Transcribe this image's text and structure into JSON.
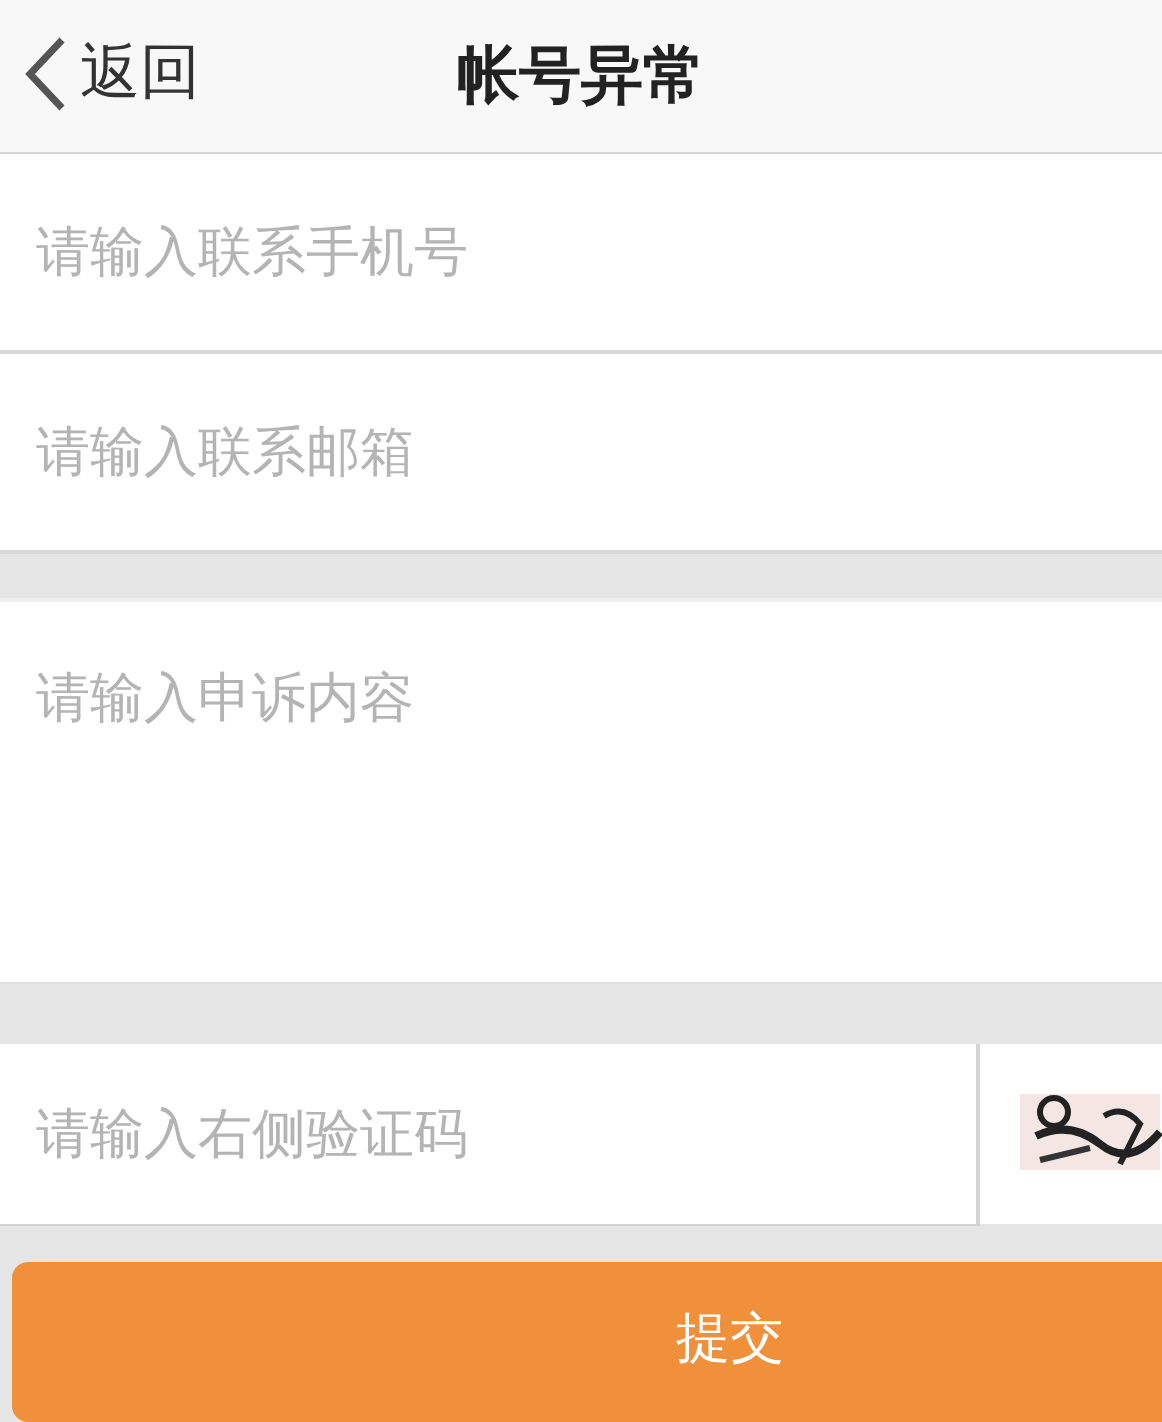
{
  "header": {
    "back": "返回",
    "title": "帐号异常"
  },
  "fields": [
    {
      "kind": "input",
      "placeholder": "请输入联系手机号"
    },
    {
      "kind": "input",
      "placeholder": "请输入联系邮箱"
    },
    {
      "kind": "textarea",
      "placeholder": "请输入申诉内容"
    },
    {
      "kind": "captcha",
      "placeholder": "请输入右侧验证码"
    }
  ],
  "submit": "提交"
}
